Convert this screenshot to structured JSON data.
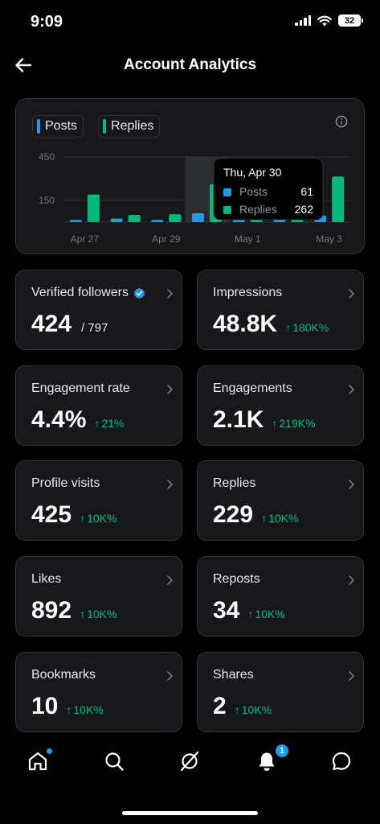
{
  "status_bar": {
    "time": "9:09",
    "battery": "32"
  },
  "header": {
    "title": "Account Analytics"
  },
  "chart_card": {
    "legend": [
      {
        "label": "Posts",
        "color": "#1d9bf0"
      },
      {
        "label": "Replies",
        "color": "#00ba7c"
      }
    ],
    "tooltip": {
      "date": "Thu, Apr 30",
      "rows": [
        {
          "label": "Posts",
          "value": "61",
          "color": "#1d9bf0"
        },
        {
          "label": "Replies",
          "value": "262",
          "color": "#00ba7c"
        }
      ]
    }
  },
  "chart_data": {
    "type": "bar",
    "categories": [
      "Apr 27",
      "Apr 28",
      "Apr 29",
      "Apr 30",
      "May 1",
      "May 2",
      "May 3"
    ],
    "x_tick_labels": [
      "Apr 27",
      "Apr 29",
      "May 1",
      "May 3"
    ],
    "y_tick_labels": [
      "450",
      "150"
    ],
    "y_ticks": [
      450,
      150
    ],
    "ylim": [
      0,
      450
    ],
    "series": [
      {
        "name": "Posts",
        "color": "#1d9bf0",
        "values": [
          15,
          25,
          15,
          61,
          15,
          15,
          45
        ]
      },
      {
        "name": "Replies",
        "color": "#00ba7c",
        "values": [
          190,
          50,
          55,
          262,
          15,
          15,
          315
        ]
      }
    ],
    "highlight_category": "Apr 30"
  },
  "metrics": [
    {
      "label": "Verified followers",
      "value": "424",
      "sub": "/ 797",
      "change": "",
      "verified": true
    },
    {
      "label": "Impressions",
      "value": "48.8K",
      "sub": "",
      "change": "180K%"
    },
    {
      "label": "Engagement rate",
      "value": "4.4%",
      "sub": "",
      "change": "21%"
    },
    {
      "label": "Engagements",
      "value": "2.1K",
      "sub": "",
      "change": "219K%"
    },
    {
      "label": "Profile visits",
      "value": "425",
      "sub": "",
      "change": "10K%"
    },
    {
      "label": "Replies",
      "value": "229",
      "sub": "",
      "change": "10K%"
    },
    {
      "label": "Likes",
      "value": "892",
      "sub": "",
      "change": "10K%"
    },
    {
      "label": "Reposts",
      "value": "34",
      "sub": "",
      "change": "10K%"
    },
    {
      "label": "Bookmarks",
      "value": "10",
      "sub": "",
      "change": "10K%"
    },
    {
      "label": "Shares",
      "value": "2",
      "sub": "",
      "change": "10K%"
    }
  ],
  "bottom_nav": {
    "items": [
      "home-icon",
      "search-icon",
      "grok-icon",
      "notifications-icon",
      "messages-icon"
    ],
    "notification_count": "1"
  },
  "colors": {
    "accent": "#1d9bf0",
    "positive": "#00ba7c",
    "card": "#16181c",
    "border": "#2f3336"
  }
}
